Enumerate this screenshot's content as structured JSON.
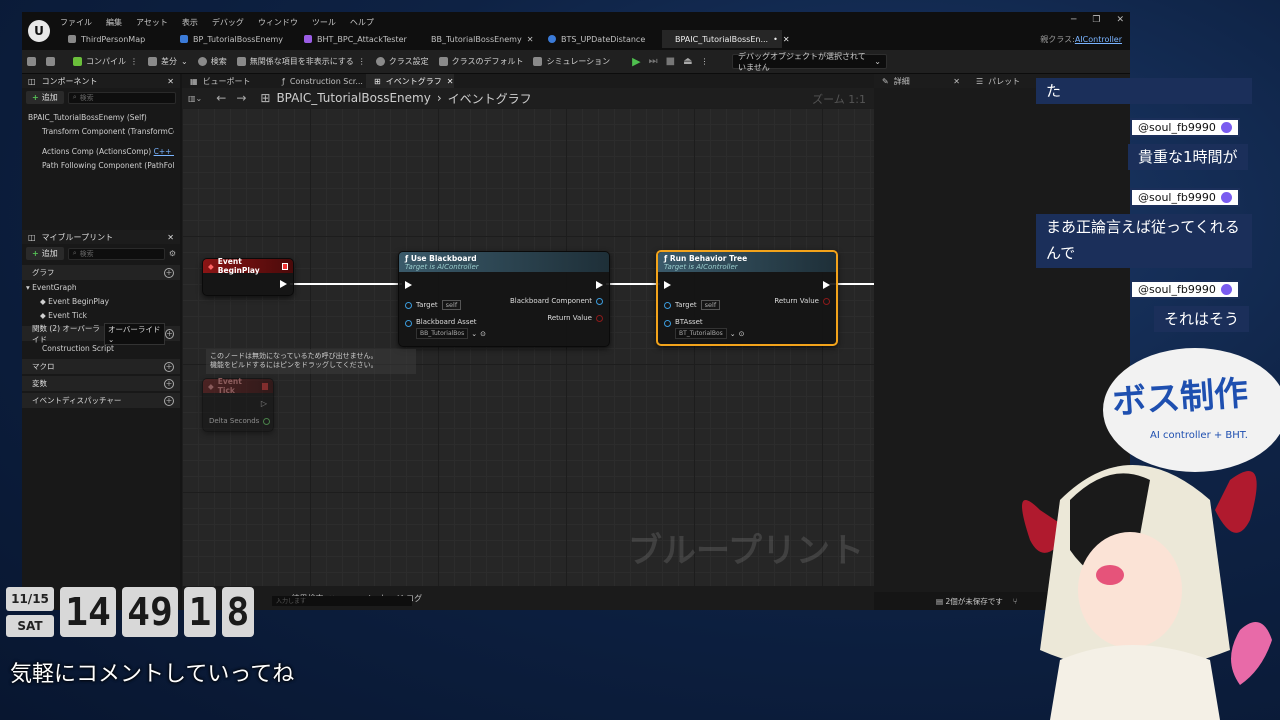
{
  "menu": [
    "ファイル",
    "編集",
    "アセット",
    "表示",
    "デバッグ",
    "ウィンドウ",
    "ツール",
    "ヘルプ"
  ],
  "tabs": [
    {
      "label": "ThirdPersonMap",
      "color": "#888888"
    },
    {
      "label": "BP_TutorialBossEnemy",
      "color": "#3b7bd8"
    },
    {
      "label": "BHT_BPC_AttackTester",
      "color": "#9b5de5"
    },
    {
      "label": "BB_TutorialBossEnemy",
      "color": "#9b5de5"
    },
    {
      "label": "BTS_UPDateDistance",
      "color": "#3b7bd8"
    },
    {
      "label": "BPAIC_TutorialBossEn...",
      "color": "#3b7bd8"
    }
  ],
  "parent_class": {
    "label": "親クラス:",
    "value": "AIController"
  },
  "toolbar": {
    "compile": "コンパイル",
    "diff": "差分",
    "find": "検索",
    "hide_unrelated": "無関係な項目を非表示にする",
    "class_settings": "クラス設定",
    "class_defaults": "クラスのデフォルト",
    "simulation": "シミュレーション",
    "debug_object": "デバッグオブジェクトが選択されていません"
  },
  "components": {
    "title": "コンポーネント",
    "add": "追加",
    "search_placeholder": "検索",
    "items": [
      "BPAIC_TutorialBossEnemy (Self)",
      "Transform Component (TransformCo",
      "Actions Comp (ActionsComp)",
      "Path Following Component (PathFollo"
    ],
    "cpp_tag": "C++ で"
  },
  "my_blueprint": {
    "title": "マイブループリント",
    "add": "追加",
    "search_placeholder": "検索",
    "graph_section": "グラフ",
    "event_graph": "EventGraph",
    "events": [
      "Event BeginPlay",
      "Event Tick"
    ],
    "functions": "関数 (2) オーバーライド",
    "override_btn": "オーバーライド",
    "construction_script": "Construction Script",
    "macros": "マクロ",
    "variables": "変数",
    "dispatchers": "イベントディスパッチャー"
  },
  "graph_tabs": [
    "ビューポート",
    "Construction Scr...",
    "イベントグラフ"
  ],
  "breadcrumb": {
    "root": "BPAIC_TutorialBossEnemy",
    "current": "イベントグラフ"
  },
  "zoom": "ズーム 1:1",
  "watermark": "ブループリント",
  "nodes": {
    "begin_play": {
      "title": "Event BeginPlay"
    },
    "use_blackboard": {
      "title": "Use Blackboard",
      "subtitle": "Target is AIController",
      "target": "Target",
      "self": "self",
      "bb_asset": "Blackboard Asset",
      "bb_asset_value": "BB_TutorialBos",
      "bb_component": "Blackboard Component",
      "return_value": "Return Value"
    },
    "run_bt": {
      "title": "Run Behavior Tree",
      "subtitle": "Target is AIController",
      "target": "Target",
      "self": "self",
      "bt_asset": "BTAsset",
      "bt_asset_value": "BT_TutorialBos",
      "return_value": "Return Value"
    },
    "event_tick": {
      "title": "Event Tick",
      "delta": "Delta Seconds"
    },
    "disabled_note": "このノードは無効になっているため呼び出せません。\n機能をビルドするにはピンをドラッグしてください。"
  },
  "side_tabs": {
    "details": "詳細",
    "palette": "パレット"
  },
  "lower_tabs": {
    "find_results": "結果検索",
    "message_log": "メッセージ ログ",
    "hint": "入力します"
  },
  "status": {
    "unsaved": "2個が未保存です"
  },
  "clock": {
    "date": "11/15",
    "day": "SAT",
    "hour": "14",
    "minute": "49",
    "s1": "1",
    "s2": "8"
  },
  "comment_prompt": "気軽にコメントしていってね",
  "chat": [
    {
      "name": "",
      "message": "た"
    },
    {
      "name": "@soul_fb9990",
      "message": "貴重な1時間が"
    },
    {
      "name": "@soul_fb9990",
      "message": "まあ正論言えば従ってくれるんで"
    },
    {
      "name": "@soul_fb9990",
      "message": "それはそう"
    }
  ],
  "avatar_sign": {
    "title": "ボス制作",
    "sub": "AI controller + BHT."
  }
}
